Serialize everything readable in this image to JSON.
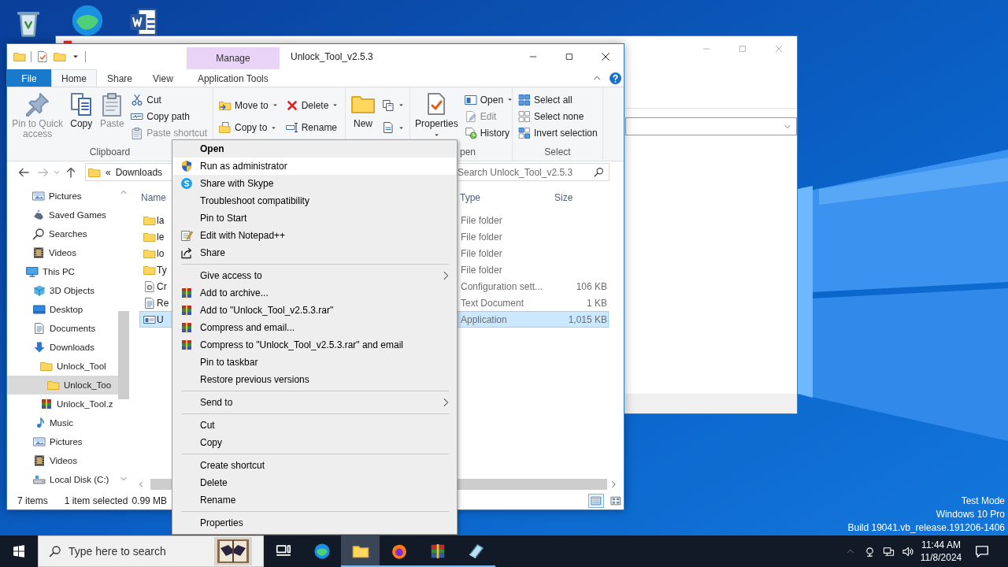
{
  "explorer": {
    "title": "Unlock_Tool_v2.5.3",
    "context_group": "Manage",
    "tabs": [
      {
        "label": "File",
        "kind": "file",
        "selected": false
      },
      {
        "label": "Home",
        "kind": "tab",
        "selected": true
      },
      {
        "label": "Share",
        "kind": "tab",
        "selected": false
      },
      {
        "label": "View",
        "kind": "tab",
        "selected": false
      },
      {
        "label": "Application Tools",
        "kind": "context",
        "selected": false
      }
    ],
    "ribbon": [
      {
        "label": "Clipboard",
        "columns": [
          [
            {
              "label": "Pin to Quick access",
              "kind": "large",
              "disabled": true,
              "dropdown": false
            }
          ],
          [
            {
              "label": "Copy",
              "kind": "large",
              "disabled": false,
              "dropdown": false
            }
          ],
          [
            {
              "label": "Paste",
              "kind": "large",
              "disabled": true,
              "dropdown": false
            }
          ],
          [
            {
              "label": "Cut",
              "kind": "small",
              "disabled": false,
              "dropdown": false
            },
            {
              "label": "Copy path",
              "kind": "small",
              "disabled": false,
              "dropdown": false
            },
            {
              "label": "Paste shortcut",
              "kind": "small",
              "disabled": true,
              "dropdown": false
            }
          ]
        ]
      },
      {
        "columns": [
          [
            {
              "label": "Move to",
              "kind": "small",
              "disabled": false,
              "dropdown": true
            },
            {
              "label": "Copy to",
              "kind": "small",
              "disabled": false,
              "dropdown": true
            }
          ],
          [
            {
              "label": "Delete",
              "kind": "small",
              "disabled": false,
              "dropdown": true
            },
            {
              "label": "Rename",
              "kind": "small",
              "disabled": false,
              "dropdown": false
            }
          ]
        ]
      },
      {
        "columns": [
          [
            {
              "label": "New",
              "kind": "large",
              "disabled": false,
              "dropdown": false
            }
          ],
          [
            {
              "kind": "small",
              "dropdown": true
            },
            {
              "kind": "small",
              "dropdown": true
            }
          ]
        ]
      },
      {
        "label": "pen",
        "columns": [
          [
            {
              "label": "Properties",
              "kind": "large",
              "disabled": false,
              "dropdown": true
            }
          ],
          [
            {
              "label": "Open",
              "kind": "small",
              "disabled": false,
              "dropdown": true
            },
            {
              "label": "Edit",
              "kind": "small",
              "disabled": true,
              "dropdown": false
            },
            {
              "label": "History",
              "kind": "small",
              "disabled": false,
              "dropdown": false
            }
          ]
        ]
      },
      {
        "label": "Select",
        "columns": [
          [
            {
              "label": "Select all",
              "kind": "small",
              "disabled": false,
              "dropdown": false
            },
            {
              "label": "Select none",
              "kind": "small",
              "disabled": false,
              "dropdown": false
            },
            {
              "label": "Invert selection",
              "kind": "small",
              "disabled": false,
              "dropdown": false
            }
          ]
        ]
      }
    ],
    "address": {
      "back": {
        "disabled": false
      },
      "forward": {
        "disabled": true
      },
      "overflow": "«",
      "path": "Downloads",
      "search_placeholder": "Search Unlock_Tool_v2.5.3"
    },
    "navigation": [
      {
        "label": "Pictures",
        "selected": false
      },
      {
        "label": "Saved Games",
        "selected": false
      },
      {
        "label": "Searches",
        "selected": false
      },
      {
        "label": "Videos",
        "selected": false
      },
      {
        "label": "This PC",
        "selected": false,
        "children": [
          {
            "label": "3D Objects",
            "selected": false
          },
          {
            "label": "Desktop",
            "selected": false
          },
          {
            "label": "Documents",
            "selected": false
          },
          {
            "label": "Downloads",
            "selected": false,
            "children": [
              {
                "label": "Unlock_Tool",
                "selected": false,
                "children": [
                  {
                    "label": "Unlock_Too",
                    "selected": true
                  }
                ]
              },
              {
                "label": "Unlock_Tool.z",
                "selected": false
              }
            ]
          },
          {
            "label": "Music",
            "selected": false
          },
          {
            "label": "Pictures",
            "selected": false
          },
          {
            "label": "Videos",
            "selected": false
          },
          {
            "label": "Local Disk (C:)",
            "selected": false
          }
        ]
      }
    ],
    "columns": [
      "Name",
      "Type",
      "Size"
    ],
    "files": [
      {
        "name": "la",
        "type": "File folder",
        "kind": "folder",
        "selected": false
      },
      {
        "name": "le",
        "type": "File folder",
        "kind": "folder",
        "selected": false
      },
      {
        "name": "lo",
        "type": "File folder",
        "kind": "folder",
        "selected": false
      },
      {
        "name": "Ty",
        "type": "File folder",
        "kind": "folder",
        "selected": false
      },
      {
        "name": "Cr",
        "type": "Configuration sett...",
        "size": "106 KB",
        "kind": "config",
        "selected": false
      },
      {
        "name": "Re",
        "type": "Text Document",
        "size": "1 KB",
        "kind": "text",
        "selected": false
      },
      {
        "name": "U",
        "type": "Application",
        "size": "1,015 KB",
        "kind": "app",
        "selected": true
      }
    ],
    "status": {
      "count": "7 items",
      "selection": "1 item selected",
      "size": "0.99 MB",
      "views": [
        {
          "selected": true
        },
        {
          "selected": false
        }
      ]
    }
  },
  "context_menu": {
    "sections": [
      [
        {
          "label": "Open",
          "default": true,
          "submenu": false,
          "highlighted": false
        },
        {
          "label": "Run as administrator",
          "default": false,
          "submenu": false,
          "highlighted": true
        },
        {
          "label": "Share with Skype",
          "default": false,
          "submenu": false,
          "highlighted": false
        },
        {
          "label": "Troubleshoot compatibility",
          "default": false,
          "submenu": false,
          "highlighted": false
        },
        {
          "label": "Pin to Start",
          "default": false,
          "submenu": false,
          "highlighted": false
        },
        {
          "label": "Edit with Notepad++",
          "default": false,
          "submenu": false,
          "highlighted": false
        },
        {
          "label": "Share",
          "default": false,
          "submenu": false,
          "highlighted": false
        }
      ],
      [
        {
          "label": "Give access to",
          "default": false,
          "submenu": true,
          "highlighted": false
        },
        {
          "label": "Add to archive...",
          "default": false,
          "submenu": false,
          "highlighted": false
        },
        {
          "label": "Add to \"Unlock_Tool_v2.5.3.rar\"",
          "default": false,
          "submenu": false,
          "highlighted": false
        },
        {
          "label": "Compress and email...",
          "default": false,
          "submenu": false,
          "highlighted": false
        },
        {
          "label": "Compress to \"Unlock_Tool_v2.5.3.rar\" and email",
          "default": false,
          "submenu": false,
          "highlighted": false
        },
        {
          "label": "Pin to taskbar",
          "default": false,
          "submenu": false,
          "highlighted": false
        },
        {
          "label": "Restore previous versions",
          "default": false,
          "submenu": false,
          "highlighted": false
        }
      ],
      [
        {
          "label": "Send to",
          "default": false,
          "submenu": true,
          "highlighted": false
        }
      ],
      [
        {
          "label": "Cut",
          "default": false,
          "submenu": false,
          "highlighted": false
        },
        {
          "label": "Copy",
          "default": false,
          "submenu": false,
          "highlighted": false
        }
      ],
      [
        {
          "label": "Create shortcut",
          "default": false,
          "submenu": false,
          "highlighted": false
        },
        {
          "label": "Delete",
          "default": false,
          "submenu": false,
          "highlighted": false
        },
        {
          "label": "Rename",
          "default": false,
          "submenu": false,
          "highlighted": false
        }
      ],
      [
        {
          "label": "Properties",
          "default": false,
          "submenu": false,
          "highlighted": false
        }
      ]
    ]
  },
  "taskbar": {
    "search_placeholder": "Type here to search",
    "apps": [
      {
        "running": false,
        "active": false
      },
      {
        "running": false,
        "active": false
      },
      {
        "running": true,
        "active": true
      },
      {
        "running": true,
        "active": false
      },
      {
        "running": true,
        "active": false
      },
      {
        "running": true,
        "active": false
      }
    ],
    "time": "11:44 AM",
    "date": "11/8/2024"
  },
  "desktop_text": [
    "Test Mode",
    "Windows 10 Pro",
    "Build 19041.vb_release.191206-1406"
  ]
}
